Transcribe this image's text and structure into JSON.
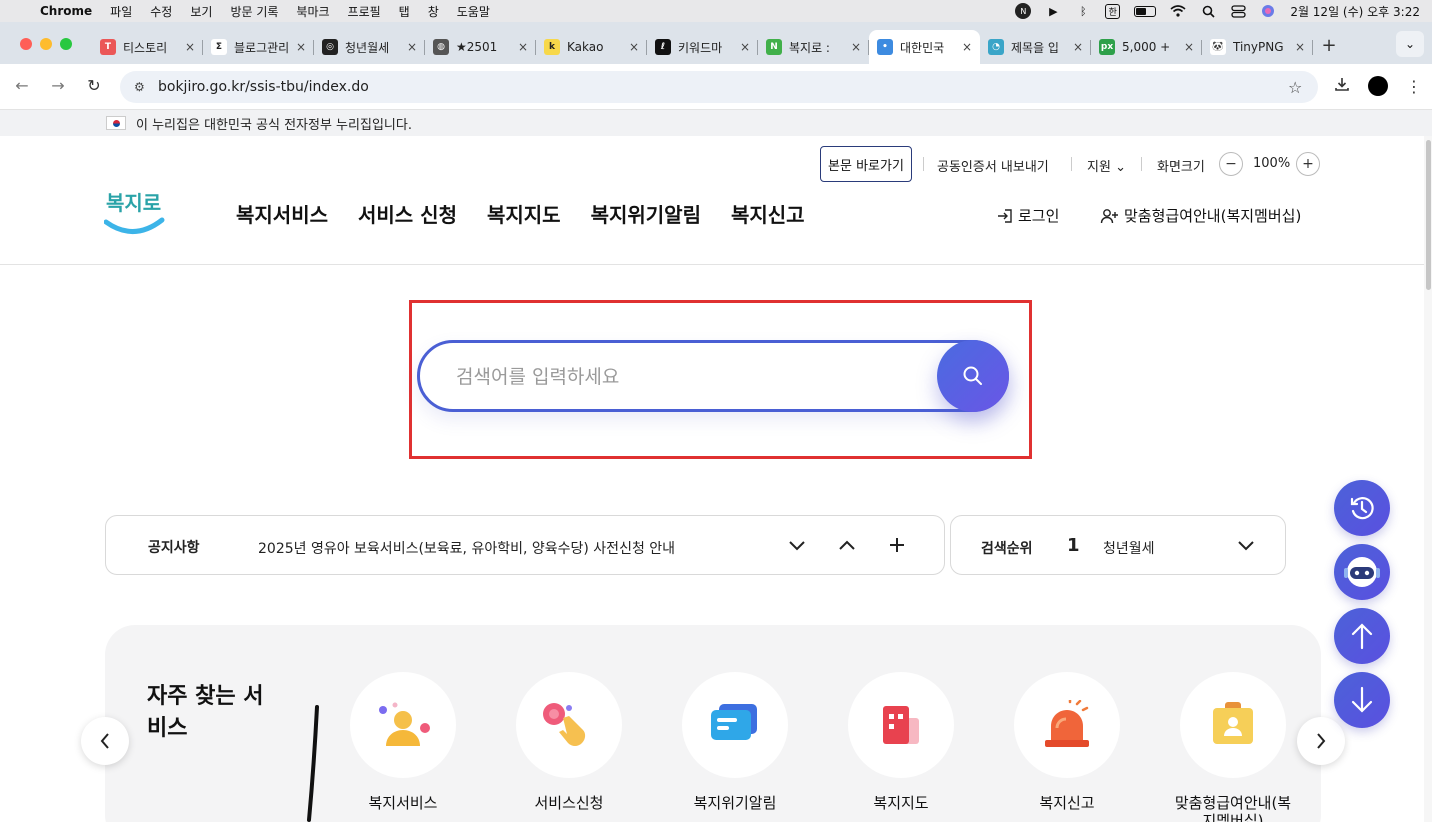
{
  "menubar": {
    "app_name": "Chrome",
    "menus": [
      "파일",
      "수정",
      "보기",
      "방문 기록",
      "북마크",
      "프로필",
      "탭",
      "창",
      "도움말"
    ],
    "status_badge": "N",
    "input_method": "한",
    "clock": "2월 12일 (수) 오후 3:22"
  },
  "tabs": [
    {
      "title": "티스토리",
      "favicon": "T",
      "color": "#eb5757"
    },
    {
      "title": "블로그관리",
      "favicon": "Σ",
      "color": "#ffffff"
    },
    {
      "title": "청년월세",
      "favicon": "◎",
      "color": "#222222"
    },
    {
      "title": "★2501",
      "favicon": "◍",
      "color": "#555555"
    },
    {
      "title": "Kakao",
      "favicon": "k",
      "color": "#f7d84a"
    },
    {
      "title": "키워드마",
      "favicon": "ℓ",
      "color": "#111111"
    },
    {
      "title": "복지로 :",
      "favicon": "N",
      "color": "#41b04a"
    },
    {
      "title": "대한민국",
      "favicon": "•",
      "color": "#3d8be0"
    },
    {
      "title": "제목을 입",
      "favicon": "◔",
      "color": "#3aa5c8"
    },
    {
      "title": "5,000 +",
      "favicon": "px",
      "color": "#2ea04a"
    },
    {
      "title": "TinyPNG",
      "favicon": "🐼",
      "color": "#ffffff"
    }
  ],
  "address_bar": {
    "url": "bokjiro.go.kr/ssis-tbu/index.do"
  },
  "gov_banner": "이 누리집은 대한민국 공식 전자정부 누리집입니다.",
  "util": {
    "skip": "본문 바로가기",
    "cert": "공동인증서 내보내기",
    "support": "지원",
    "screen_size": "화면크기",
    "zoom": "100%",
    "zoom_out": "−",
    "zoom_in": "+"
  },
  "logo_text": "복지로",
  "nav": [
    "복지서비스",
    "서비스 신청",
    "복지지도",
    "복지위기알림",
    "복지신고"
  ],
  "login": "로그인",
  "membership": "맞춤형급여안내(복지멤버십)",
  "search": {
    "placeholder": "검색어를 입력하세요"
  },
  "notice": {
    "label": "공지사항",
    "text": "2025년 영유아 보육서비스(보육료, 유아학비, 양육수당) 사전신청 안내"
  },
  "ranking": {
    "label": "검색순위",
    "rank": "1",
    "keyword": "청년월세"
  },
  "services": {
    "heading": "자주 찾는 서비스",
    "items": [
      {
        "label": "복지서비스",
        "icon": "person-icon"
      },
      {
        "label": "서비스신청",
        "icon": "hand-pointer-icon"
      },
      {
        "label": "복지위기알림",
        "icon": "chat-bubble-icon"
      },
      {
        "label": "복지지도",
        "icon": "building-icon"
      },
      {
        "label": "복지신고",
        "icon": "siren-icon"
      },
      {
        "label": "맞춤형급여안내(복지멤버십)",
        "icon": "id-card-icon"
      }
    ]
  },
  "colors": {
    "accent": "#4a5fd4",
    "highlight": "#e03131"
  }
}
